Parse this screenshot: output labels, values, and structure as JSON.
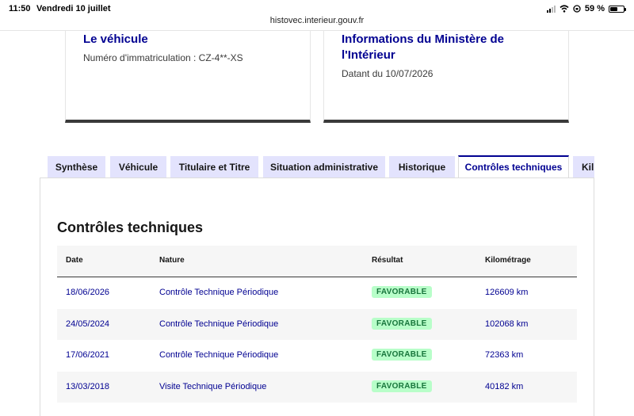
{
  "status_bar": {
    "time": "11:50",
    "date": "Vendredi 10 juillet",
    "battery": "59 %",
    "battery_level": 0.59
  },
  "browser": {
    "url": "histovec.interieur.gouv.fr"
  },
  "cards": {
    "vehicle": {
      "title": "Le véhicule",
      "text": "Numéro d'immatriculation : CZ-4**-XS"
    },
    "ministry": {
      "title": "Informations du Ministère de l'Intérieur",
      "text": "Datant du 10/07/2026"
    }
  },
  "tabs": [
    {
      "label": "Synthèse",
      "active": false
    },
    {
      "label": "Véhicule",
      "active": false
    },
    {
      "label": "Titulaire et Titre",
      "active": false
    },
    {
      "label": "Situation administrative",
      "active": false
    },
    {
      "label": "Historique",
      "active": false
    },
    {
      "label": "Contrôles techniques",
      "active": true
    },
    {
      "label": "Kil",
      "active": false
    }
  ],
  "section": {
    "title": "Contrôles techniques",
    "columns": [
      "Date",
      "Nature",
      "Résultat",
      "Kilométrage"
    ],
    "rows": [
      {
        "date": "18/06/2026",
        "nature": "Contrôle Technique Périodique",
        "result": "FAVORABLE",
        "km": "126609 km"
      },
      {
        "date": "24/05/2024",
        "nature": "Contrôle Technique Périodique",
        "result": "FAVORABLE",
        "km": "102068 km"
      },
      {
        "date": "17/06/2021",
        "nature": "Contrôle Technique Périodique",
        "result": "FAVORABLE",
        "km": "72363 km"
      },
      {
        "date": "13/03/2018",
        "nature": "Visite Technique Périodique",
        "result": "FAVORABLE",
        "km": "40182 km"
      }
    ]
  },
  "colors": {
    "brand_blue": "#000091",
    "tab_bg": "#e3e3fd",
    "badge_bg": "#b8fec9",
    "badge_text": "#18753c"
  }
}
